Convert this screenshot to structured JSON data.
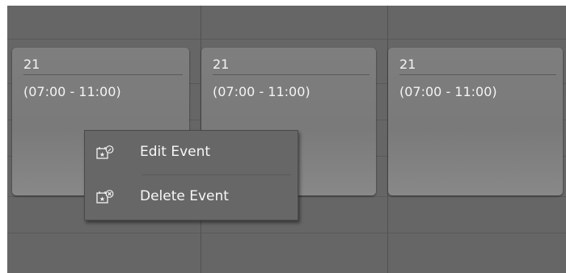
{
  "events": [
    {
      "title": "21",
      "time": "(07:00 - 11:00)"
    },
    {
      "title": "21",
      "time": "(07:00 - 11:00)"
    },
    {
      "title": "21",
      "time": "(07:00 - 11:00)"
    }
  ],
  "context_menu": {
    "items": [
      {
        "label": "Edit Event",
        "icon": "calendar-edit-icon"
      },
      {
        "label": "Delete Event",
        "icon": "calendar-delete-icon"
      }
    ]
  },
  "colors": {
    "background": "#666666",
    "event_fill": "#7e7e7e",
    "menu_fill": "#676767",
    "text": "#f4f4f4"
  }
}
